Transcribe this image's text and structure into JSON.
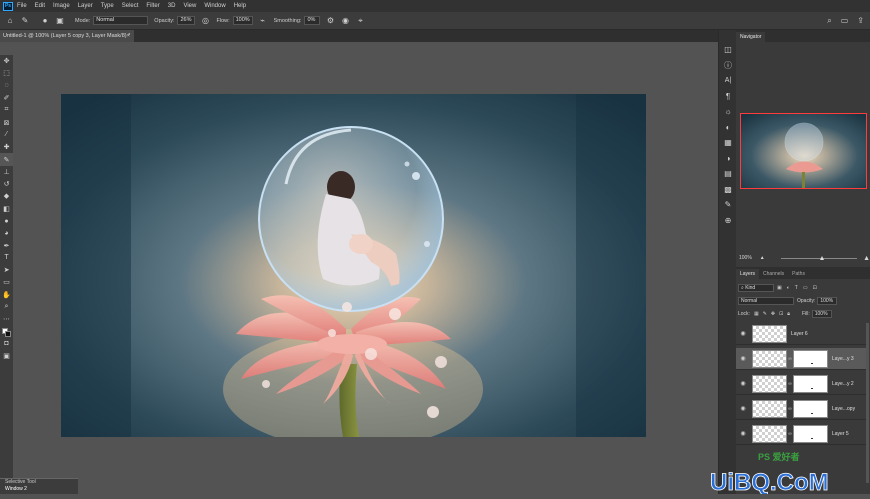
{
  "menubar": {
    "logo": "Ps",
    "items": [
      "File",
      "Edit",
      "Image",
      "Layer",
      "Type",
      "Select",
      "Filter",
      "3D",
      "View",
      "Window",
      "Help"
    ]
  },
  "options": {
    "mode_label": "Mode:",
    "mode_value": "Normal",
    "opacity_label": "Opacity:",
    "opacity_value": "26%",
    "flow_label": "Flow:",
    "flow_value": "100%",
    "smoothing_label": "Smoothing:",
    "smoothing_value": "0%"
  },
  "document": {
    "tab_title": "Untitled-1 @ 100% (Layer 5 copy 3, Layer Mask/8) *",
    "close_glyph": "×"
  },
  "navigator": {
    "tab_label": "Navigator",
    "zoom_value": "100%",
    "zoom_fraction": 0.55
  },
  "layers_panel": {
    "tabs": [
      "Layers",
      "Channels",
      "Paths"
    ],
    "filter_kind": "Kind",
    "blend_mode": "Normal",
    "opacity_label": "Opacity:",
    "opacity_value": "100%",
    "lock_label": "Lock:",
    "fill_label": "Fill:",
    "fill_value": "100%",
    "layers": [
      {
        "name": "Layer 6",
        "has_mask": false,
        "selected": false
      },
      {
        "name": "Laye...y 3",
        "has_mask": true,
        "selected": true
      },
      {
        "name": "Laye...y 2",
        "has_mask": true,
        "selected": false
      },
      {
        "name": "Laye...opy",
        "has_mask": true,
        "selected": false
      },
      {
        "name": "Layer 5",
        "has_mask": true,
        "selected": false
      }
    ]
  },
  "mini_panel": {
    "title": "Selective Tool",
    "row": "Window 2"
  },
  "watermark": {
    "brand": "UiBQ.CoM",
    "seal": "PS 爱好者"
  },
  "colors": {
    "accent": "#31a8ff",
    "nav_frame": "#ff3b3b",
    "watermark_blue": "#2a6fd6",
    "watermark_green": "#3aa040"
  },
  "icons": {
    "toolbar": [
      "move-icon",
      "marquee-icon",
      "lasso-icon",
      "quick-select-icon",
      "crop-icon",
      "frame-icon",
      "eyedropper-icon",
      "healing-icon",
      "brush-icon",
      "clone-stamp-icon",
      "history-brush-icon",
      "eraser-icon",
      "gradient-icon",
      "blur-icon",
      "dodge-icon",
      "pen-icon",
      "type-icon",
      "path-select-icon",
      "rectangle-icon",
      "hand-icon",
      "zoom-icon",
      "more-icon",
      "color-swatch-icon",
      "quick-mask-icon",
      "screen-mode-icon"
    ],
    "strip": [
      "history-icon",
      "info-icon",
      "character-icon",
      "paragraph-icon",
      "lightbulb-icon",
      "color-icon",
      "swatches-icon",
      "adjustments-icon",
      "styles-icon",
      "libraries-icon",
      "brushes-icon",
      "clone-source-icon"
    ]
  }
}
